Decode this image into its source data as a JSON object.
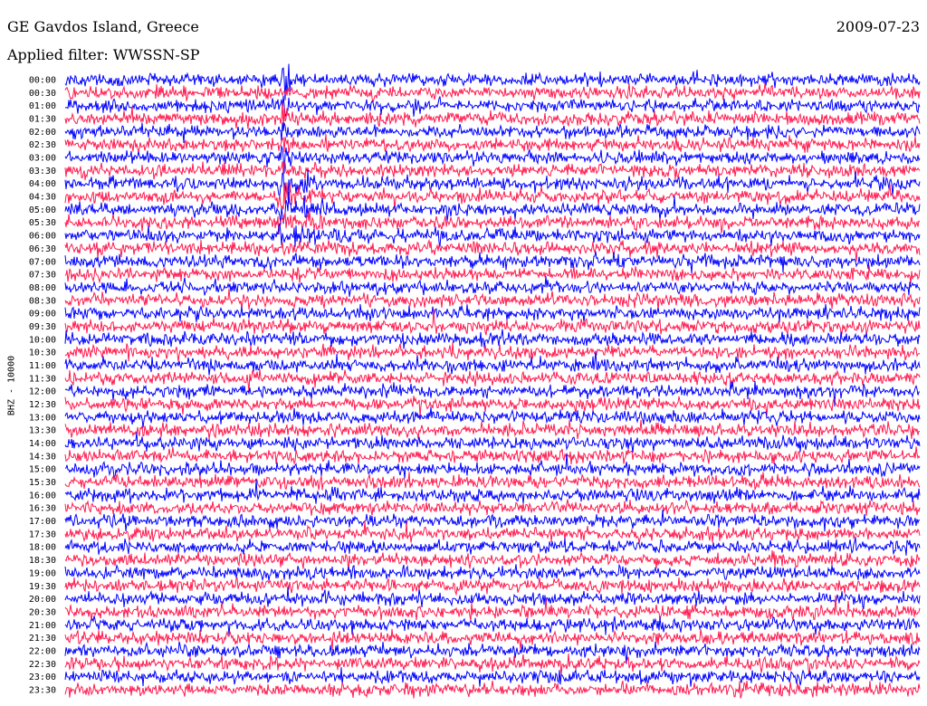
{
  "header": {
    "station": "GE Gavdos Island, Greece",
    "date": "2009-07-23",
    "filter": "Applied filter: WWSSN-SP"
  },
  "chart_data": {
    "type": "line",
    "ylabel": "BHZ - 10000",
    "time_labels": [
      "00:00",
      "00:30",
      "01:00",
      "01:30",
      "02:00",
      "02:30",
      "03:00",
      "03:30",
      "04:00",
      "04:30",
      "05:00",
      "05:30",
      "06:00",
      "06:30",
      "07:00",
      "07:30",
      "08:00",
      "08:30",
      "09:00",
      "09:30",
      "10:00",
      "10:30",
      "11:00",
      "11:30",
      "12:00",
      "12:30",
      "13:00",
      "13:30",
      "14:00",
      "14:30",
      "15:00",
      "15:30",
      "16:00",
      "16:30",
      "17:00",
      "17:30",
      "18:00",
      "18:30",
      "19:00",
      "19:30",
      "20:00",
      "20:30",
      "21:00",
      "21:30",
      "22:00",
      "22:30",
      "23:00",
      "23:30"
    ],
    "minutes_per_line": 30,
    "trace_colors": [
      "#0000ff",
      "#ff1a4f"
    ],
    "events": [
      {
        "line": 0,
        "minute": 7.6,
        "amplitude": 5.0,
        "duration_min": 0.3
      },
      {
        "line": 2,
        "minute": 7.6,
        "amplitude": 2.5,
        "duration_min": 0.4
      },
      {
        "line": 3,
        "minute": 7.6,
        "amplitude": 2.0,
        "duration_min": 0.4
      },
      {
        "line": 4,
        "minute": 7.6,
        "amplitude": 1.8,
        "duration_min": 0.4
      },
      {
        "line": 5,
        "minute": 7.6,
        "amplitude": 2.0,
        "duration_min": 0.5
      },
      {
        "line": 6,
        "minute": 7.6,
        "amplitude": 1.5,
        "duration_min": 0.5
      },
      {
        "line": 7,
        "minute": 7.6,
        "amplitude": 1.6,
        "duration_min": 0.6
      },
      {
        "line": 8,
        "minute": 7.5,
        "amplitude": 2.4,
        "duration_min": 1.4
      },
      {
        "line": 9,
        "minute": 7.5,
        "amplitude": 2.2,
        "duration_min": 1.6
      },
      {
        "line": 10,
        "minute": 7.5,
        "amplitude": 2.0,
        "duration_min": 1.8
      },
      {
        "line": 11,
        "minute": 7.5,
        "amplitude": 1.6,
        "duration_min": 2.5
      },
      {
        "line": 11,
        "minute": 13.2,
        "amplitude": 1.3,
        "duration_min": 0.8
      },
      {
        "line": 12,
        "minute": 7.5,
        "amplitude": 1.5,
        "duration_min": 3.0
      },
      {
        "line": 12,
        "minute": 13.0,
        "amplitude": 1.2,
        "duration_min": 0.8
      },
      {
        "line": 14,
        "minute": 8.0,
        "amplitude": 1.1,
        "duration_min": 1.0
      },
      {
        "line": 18,
        "minute": 14.8,
        "amplitude": 1.1,
        "duration_min": 0.5
      },
      {
        "line": 18,
        "minute": 24.5,
        "amplitude": 1.2,
        "duration_min": 0.3
      }
    ]
  }
}
